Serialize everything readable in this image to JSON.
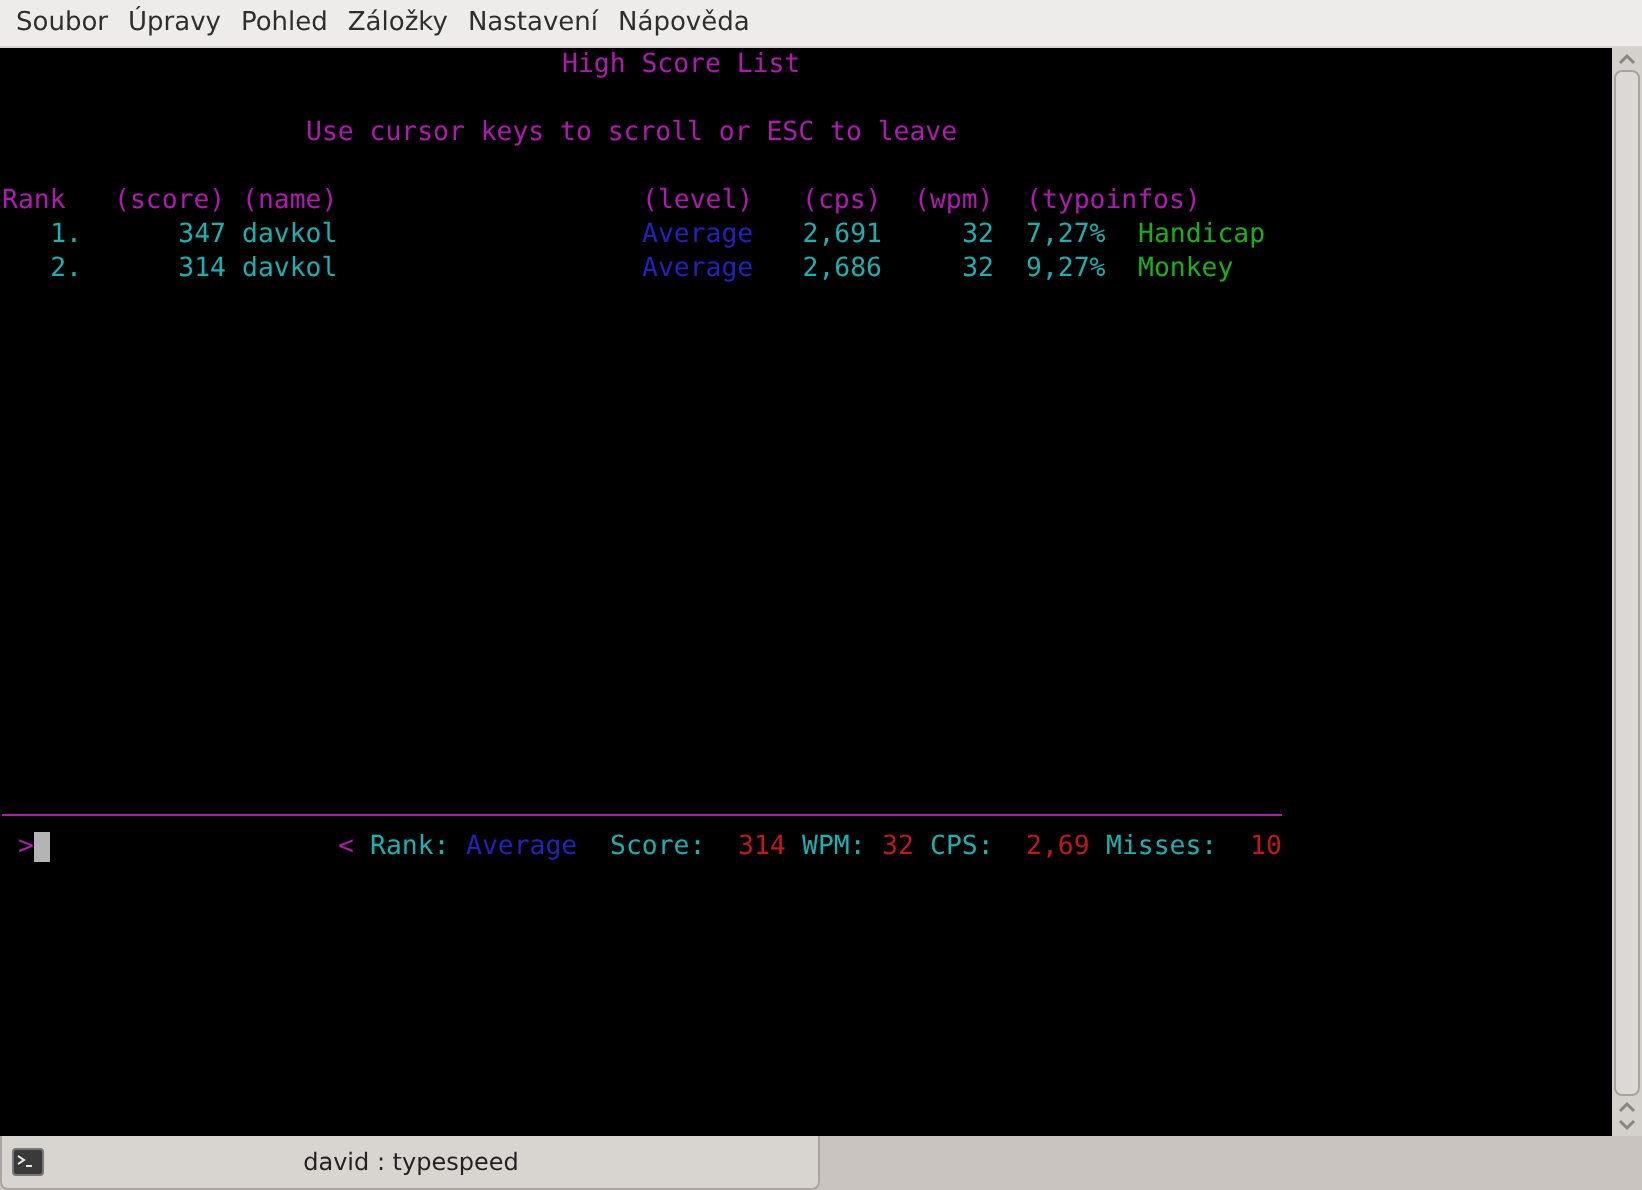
{
  "menu": [
    "Soubor",
    "Úpravy",
    "Pohled",
    "Záložky",
    "Nastavení",
    "Nápověda"
  ],
  "terminal": {
    "title": "High Score List",
    "hint": "Use cursor keys to scroll or ESC to leave",
    "header": [
      "Rank",
      "(score)",
      "(name)",
      "(level)",
      "(cps)",
      "(wpm)",
      "(typoinfos)"
    ],
    "rows": [
      {
        "rank": "1.",
        "score": "347",
        "name": "davkol",
        "level": "Average",
        "cps": "2,691",
        "wpm": "32",
        "typos": "7,27%",
        "typo_label": "Handicap"
      },
      {
        "rank": "2.",
        "score": "314",
        "name": "davkol",
        "level": "Average",
        "cps": "2,686",
        "wpm": "32",
        "typos": "9,27%",
        "typo_label": "Monkey"
      }
    ],
    "prompt": ">",
    "status": [
      {
        "text": "<",
        "kind": "marker"
      },
      {
        "text": "Rank:",
        "kind": "label"
      },
      {
        "text": "Average",
        "kind": "level"
      },
      {
        "text": "Score:",
        "kind": "label"
      },
      {
        "text": "314",
        "kind": "value"
      },
      {
        "text": "WPM:",
        "kind": "label"
      },
      {
        "text": "32",
        "kind": "value"
      },
      {
        "text": "CPS:",
        "kind": "label"
      },
      {
        "text": "2,69",
        "kind": "value"
      },
      {
        "text": "Misses:",
        "kind": "label"
      },
      {
        "text": "10",
        "kind": "value"
      }
    ]
  },
  "taskbar": {
    "task": "david : typespeed"
  }
}
